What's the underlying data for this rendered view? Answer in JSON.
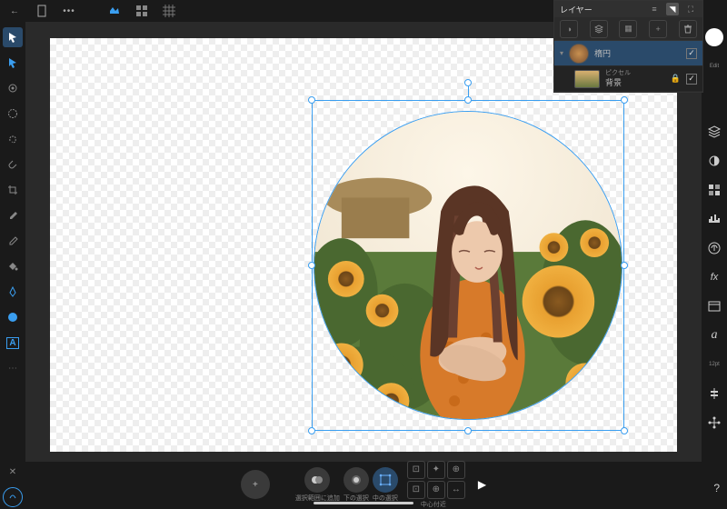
{
  "topbar": {
    "back": "←"
  },
  "layers": {
    "title": "レイヤー",
    "item_ellipse": "楕円",
    "item_bg_sub": "ピクセル",
    "item_bg": "背景"
  },
  "right": {
    "edit": "Edit",
    "textstyle_label": "12pt"
  },
  "bottombar": {
    "add": "+",
    "addToSelection": "選択範囲に追加",
    "selectBelow": "下の選択",
    "selectInside": "中の選択",
    "moveCenterInside": "中心付近"
  },
  "misc": {
    "question": "?"
  }
}
